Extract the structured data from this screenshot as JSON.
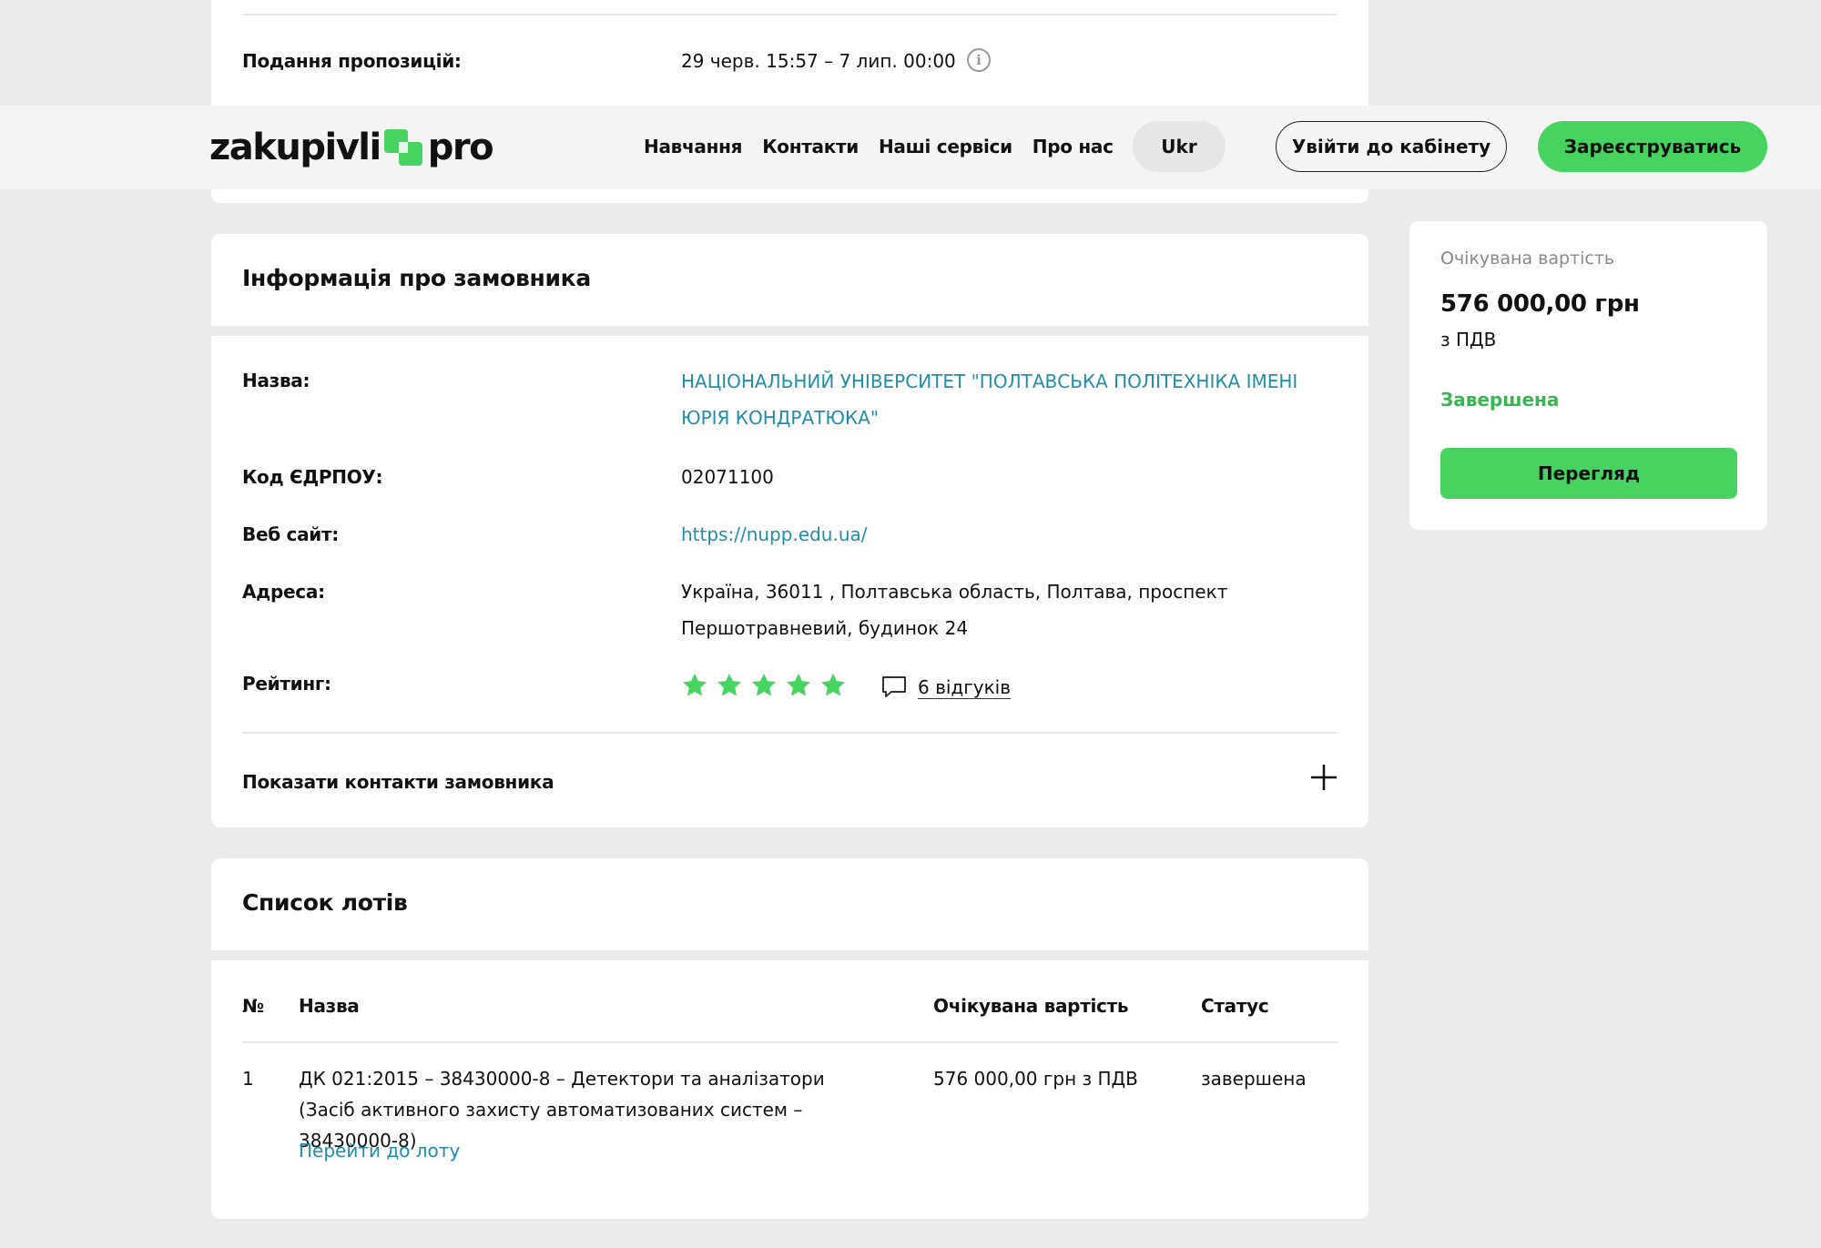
{
  "top_card": {
    "submission_label": "Подання пропозицій:",
    "submission_value": "29 черв. 15:57 – 7 лип. 00:00"
  },
  "header": {
    "logo_left": "zakupivli",
    "logo_right": "pro",
    "nav": [
      "Навчання",
      "Контакти",
      "Наші сервіси",
      "Про нас"
    ],
    "lang": "Ukr",
    "login": "Увійти до кабінету",
    "register": "Зареєструватись"
  },
  "customer": {
    "title": "Інформація про замовника",
    "name_label": "Назва:",
    "name_value": "НАЦІОНАЛЬНИЙ УНІВЕРСИТЕТ \"ПОЛТАВСЬКА ПОЛІТЕХНІКА ІМЕНІ ЮРІЯ КОНДРАТЮКА\"",
    "edrpou_label": "Код ЄДРПОУ:",
    "edrpou_value": "02071100",
    "site_label": "Веб сайт:",
    "site_value": "https://nupp.edu.ua/",
    "address_label": "Адреса:",
    "address_value": "Україна, 36011 , Полтавська область, Полтава, проспект Першотравневий, будинок 24",
    "rating_label": "Рейтинг:",
    "rating_value": 5,
    "reviews": "6 відгуків",
    "show_contacts": "Показати контакти замовника"
  },
  "lots": {
    "title": "Список лотів",
    "columns": [
      "№",
      "Назва",
      "Очікувана вартість",
      "Статус"
    ],
    "rows": [
      {
        "num": "1",
        "name": "ДК 021:2015 – 38430000-8 – Детектори та аналізатори (Засіб активного захисту автоматизованих систем – 38430000-8)",
        "link": "Перейти до лоту",
        "value": "576 000,00 грн з ПДВ",
        "status": "завершена"
      }
    ]
  },
  "sidebar": {
    "label": "Очікувана вартість",
    "amount": "576 000,00 грн",
    "vat": "з ПДВ",
    "status": "Завершена",
    "button": "Перегляд"
  },
  "colors": {
    "accent_green": "#46d35f",
    "link_blue": "#1f8fa8",
    "status_green": "#35b84f"
  }
}
